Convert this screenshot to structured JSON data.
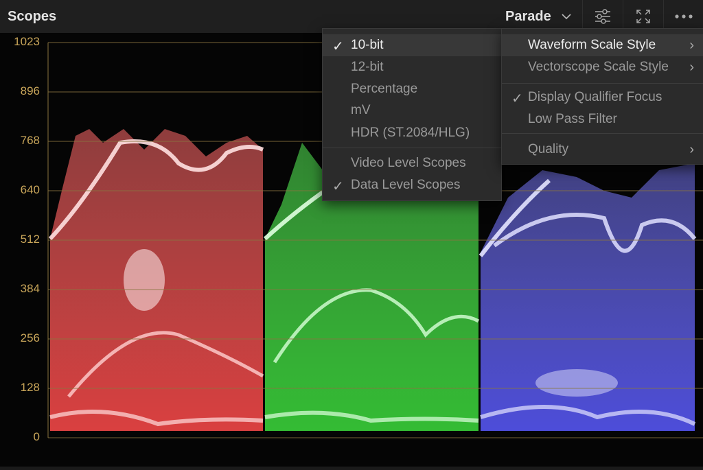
{
  "header": {
    "title": "Scopes",
    "mode_label": "Parade",
    "buttons": [
      "settings-sliders-icon",
      "expand-icon",
      "more-icon"
    ]
  },
  "scale": {
    "labels": [
      "1023",
      "896",
      "768",
      "640",
      "512",
      "384",
      "256",
      "128",
      "0"
    ]
  },
  "channels": [
    {
      "name": "red",
      "color": "#ff7a7a"
    },
    {
      "name": "green",
      "color": "#6dff6d"
    },
    {
      "name": "blue",
      "color": "#8a8aff"
    }
  ],
  "scale_menu": {
    "items": [
      {
        "label": "10-bit",
        "checked": true
      },
      {
        "label": "12-bit",
        "checked": false
      },
      {
        "label": "Percentage",
        "checked": false
      },
      {
        "label": "mV",
        "checked": false
      },
      {
        "label": "HDR (ST.2084/HLG)",
        "checked": false
      },
      {
        "label": "Video Level Scopes",
        "checked": false
      },
      {
        "label": "Data Level Scopes",
        "checked": true
      }
    ]
  },
  "options_menu": {
    "items": [
      {
        "label": "Waveform Scale Style",
        "submenu": true
      },
      {
        "label": "Vectorscope Scale Style",
        "submenu": true
      },
      {
        "label": "Display Qualifier Focus",
        "checked": true
      },
      {
        "label": "Low Pass Filter",
        "checked": false
      },
      {
        "label": "Quality",
        "submenu": true
      }
    ]
  },
  "colors": {
    "accent_gold": "#c9a65a"
  }
}
